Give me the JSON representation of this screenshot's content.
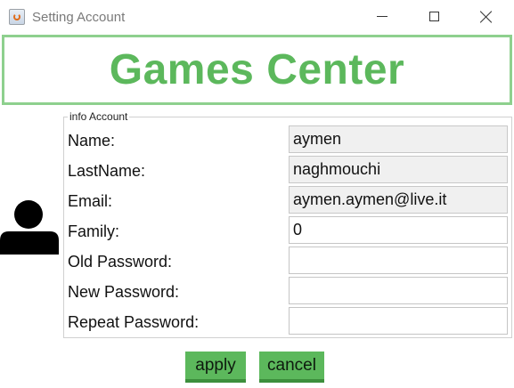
{
  "window": {
    "title": "Setting Account",
    "controls": {
      "minimize": "minimize",
      "maximize": "maximize",
      "close": "close"
    }
  },
  "banner": {
    "title": "Games Center",
    "color": "#5cb85c",
    "border_color": "#8ed08e"
  },
  "avatar": {
    "icon": "user-icon"
  },
  "form": {
    "legend": "info Account",
    "rows": [
      {
        "label": "Name:",
        "value": "aymen",
        "readonly": true
      },
      {
        "label": "LastName:",
        "value": "naghmouchi",
        "readonly": true
      },
      {
        "label": "Email:",
        "value": "aymen.aymen@live.it",
        "readonly": true
      },
      {
        "label": "Family:",
        "value": "0",
        "readonly": false
      },
      {
        "label": "Old Password:",
        "value": "",
        "readonly": false
      },
      {
        "label": "New Password:",
        "value": "",
        "readonly": false
      },
      {
        "label": "Repeat Password:",
        "value": "",
        "readonly": false
      }
    ]
  },
  "actions": {
    "apply": "apply",
    "cancel": "cancel",
    "button_color": "#5cb85c"
  }
}
